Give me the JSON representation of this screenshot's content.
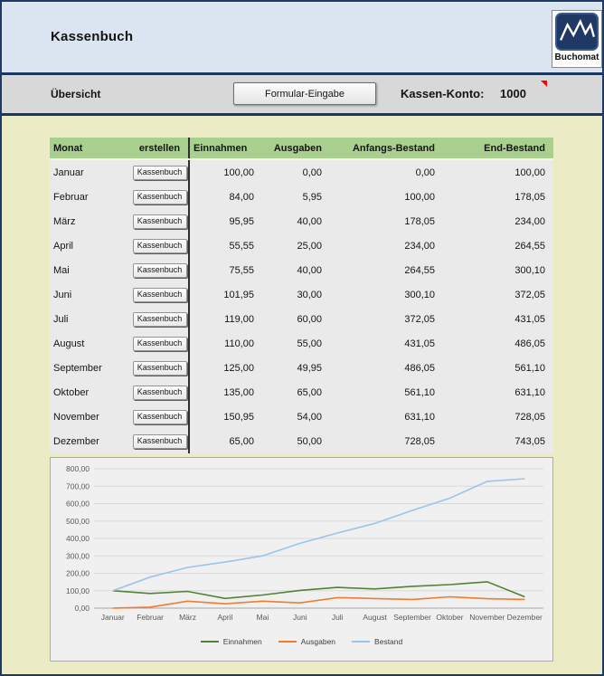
{
  "header": {
    "title": "Kassenbuch",
    "logo_text": "Buchomat"
  },
  "toolbar": {
    "section_label": "Übersicht",
    "form_button_label": "Formular-Eingabe",
    "account_label": "Kassen-Konto:",
    "account_value": "1000"
  },
  "table": {
    "columns": [
      "Monat",
      "erstellen",
      "Einnahmen",
      "Ausgaben",
      "Anfangs-Bestand",
      "End-Bestand"
    ],
    "row_button_label": "Kassenbuch",
    "rows": [
      {
        "monat": "Januar",
        "einnahmen": "100,00",
        "ausgaben": "0,00",
        "anfangs_bestand": "0,00",
        "end_bestand": "100,00"
      },
      {
        "monat": "Februar",
        "einnahmen": "84,00",
        "ausgaben": "5,95",
        "anfangs_bestand": "100,00",
        "end_bestand": "178,05"
      },
      {
        "monat": "März",
        "einnahmen": "95,95",
        "ausgaben": "40,00",
        "anfangs_bestand": "178,05",
        "end_bestand": "234,00"
      },
      {
        "monat": "April",
        "einnahmen": "55,55",
        "ausgaben": "25,00",
        "anfangs_bestand": "234,00",
        "end_bestand": "264,55"
      },
      {
        "monat": "Mai",
        "einnahmen": "75,55",
        "ausgaben": "40,00",
        "anfangs_bestand": "264,55",
        "end_bestand": "300,10"
      },
      {
        "monat": "Juni",
        "einnahmen": "101,95",
        "ausgaben": "30,00",
        "anfangs_bestand": "300,10",
        "end_bestand": "372,05"
      },
      {
        "monat": "Juli",
        "einnahmen": "119,00",
        "ausgaben": "60,00",
        "anfangs_bestand": "372,05",
        "end_bestand": "431,05"
      },
      {
        "monat": "August",
        "einnahmen": "110,00",
        "ausgaben": "55,00",
        "anfangs_bestand": "431,05",
        "end_bestand": "486,05"
      },
      {
        "monat": "September",
        "einnahmen": "125,00",
        "ausgaben": "49,95",
        "anfangs_bestand": "486,05",
        "end_bestand": "561,10"
      },
      {
        "monat": "Oktober",
        "einnahmen": "135,00",
        "ausgaben": "65,00",
        "anfangs_bestand": "561,10",
        "end_bestand": "631,10"
      },
      {
        "monat": "November",
        "einnahmen": "150,95",
        "ausgaben": "54,00",
        "anfangs_bestand": "631,10",
        "end_bestand": "728,05"
      },
      {
        "monat": "Dezember",
        "einnahmen": "65,00",
        "ausgaben": "50,00",
        "anfangs_bestand": "728,05",
        "end_bestand": "743,05"
      }
    ]
  },
  "chart_data": {
    "type": "line",
    "categories": [
      "Januar",
      "Februar",
      "März",
      "April",
      "Mai",
      "Juni",
      "Juli",
      "August",
      "September",
      "Oktober",
      "November",
      "Dezember"
    ],
    "series": [
      {
        "name": "Einnahmen",
        "color": "#538135",
        "values": [
          100.0,
          84.0,
          95.95,
          55.55,
          75.55,
          101.95,
          119.0,
          110.0,
          125.0,
          135.0,
          150.95,
          65.0
        ]
      },
      {
        "name": "Ausgaben",
        "color": "#ed7d31",
        "values": [
          0.0,
          5.95,
          40.0,
          25.0,
          40.0,
          30.0,
          60.0,
          55.0,
          49.95,
          65.0,
          54.0,
          50.0
        ]
      },
      {
        "name": "Bestand",
        "color": "#9dc3e6",
        "values": [
          100.0,
          178.05,
          234.0,
          264.55,
          300.1,
          372.05,
          431.05,
          486.05,
          561.1,
          631.1,
          728.05,
          743.05
        ]
      }
    ],
    "ylim": [
      0,
      800
    ],
    "ytick_step": 100,
    "ytick_labels": [
      "0,00",
      "100,00",
      "200,00",
      "300,00",
      "400,00",
      "500,00",
      "600,00",
      "700,00",
      "800,00"
    ],
    "grid": true,
    "legend_position": "bottom"
  },
  "colors": {
    "frame": "#17375e",
    "header_bg": "#dbe5f1",
    "toolbar_bg": "#d8d8d8",
    "page_bg": "#ebebc6",
    "table_header_bg": "#a9d08e",
    "table_row_bg": "#eaeaea",
    "comment_marker": "#ff0000",
    "logo_bg": "#1f3864"
  }
}
